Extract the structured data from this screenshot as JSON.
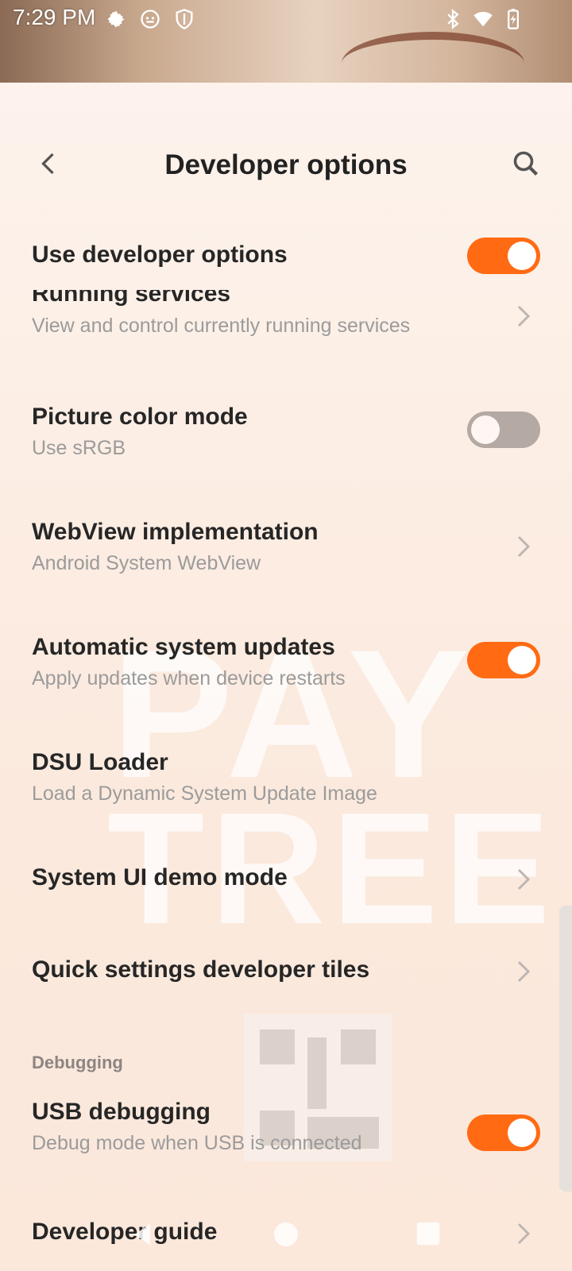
{
  "status": {
    "time": "7:29 PM",
    "left_icons": [
      "gear-icon",
      "face-icon",
      "shield-icon"
    ],
    "right_icons": [
      "bluetooth-icon",
      "wifi-icon",
      "battery-charging-icon"
    ]
  },
  "appbar": {
    "title": "Developer options",
    "back_icon": "back-arrow-icon",
    "search_icon": "search-icon"
  },
  "background": {
    "watermark_line1": "PAY",
    "watermark_line2": "TREE"
  },
  "rows": [
    {
      "id": "use-developer-options",
      "title": "Use developer options",
      "subtitle": "",
      "control": "toggle",
      "checked": true
    },
    {
      "id": "running-services",
      "title": "Running services",
      "subtitle": "View and control currently running services",
      "control": "chevron"
    },
    {
      "id": "picture-color-mode",
      "title": "Picture color mode",
      "subtitle": "Use sRGB",
      "control": "toggle",
      "checked": false
    },
    {
      "id": "webview-implementation",
      "title": "WebView implementation",
      "subtitle": "Android System WebView",
      "control": "chevron"
    },
    {
      "id": "automatic-system-updates",
      "title": "Automatic system updates",
      "subtitle": "Apply updates when device restarts",
      "control": "toggle",
      "checked": true
    },
    {
      "id": "dsu-loader",
      "title": "DSU Loader",
      "subtitle": "Load a Dynamic System Update Image",
      "control": "none"
    },
    {
      "id": "system-ui-demo-mode",
      "title": "System UI demo mode",
      "subtitle": "",
      "control": "chevron"
    },
    {
      "id": "quick-settings-developer-tiles",
      "title": "Quick settings developer tiles",
      "subtitle": "",
      "control": "chevron"
    }
  ],
  "debugging": {
    "section_label": "Debugging",
    "rows": [
      {
        "id": "usb-debugging",
        "title": "USB debugging",
        "subtitle": "Debug mode when USB is connected",
        "control": "toggle",
        "checked": true
      },
      {
        "id": "developer-guide",
        "title": "Developer guide",
        "subtitle": "",
        "control": "chevron"
      }
    ]
  },
  "colors": {
    "accent": "#ff6a13",
    "toggle_off": "#b5a9a3",
    "title_text": "#262626",
    "subtitle_text": "#9b9b9b"
  },
  "navbar": {
    "icons": [
      "nav-back-icon",
      "nav-home-icon",
      "nav-recents-icon"
    ]
  }
}
